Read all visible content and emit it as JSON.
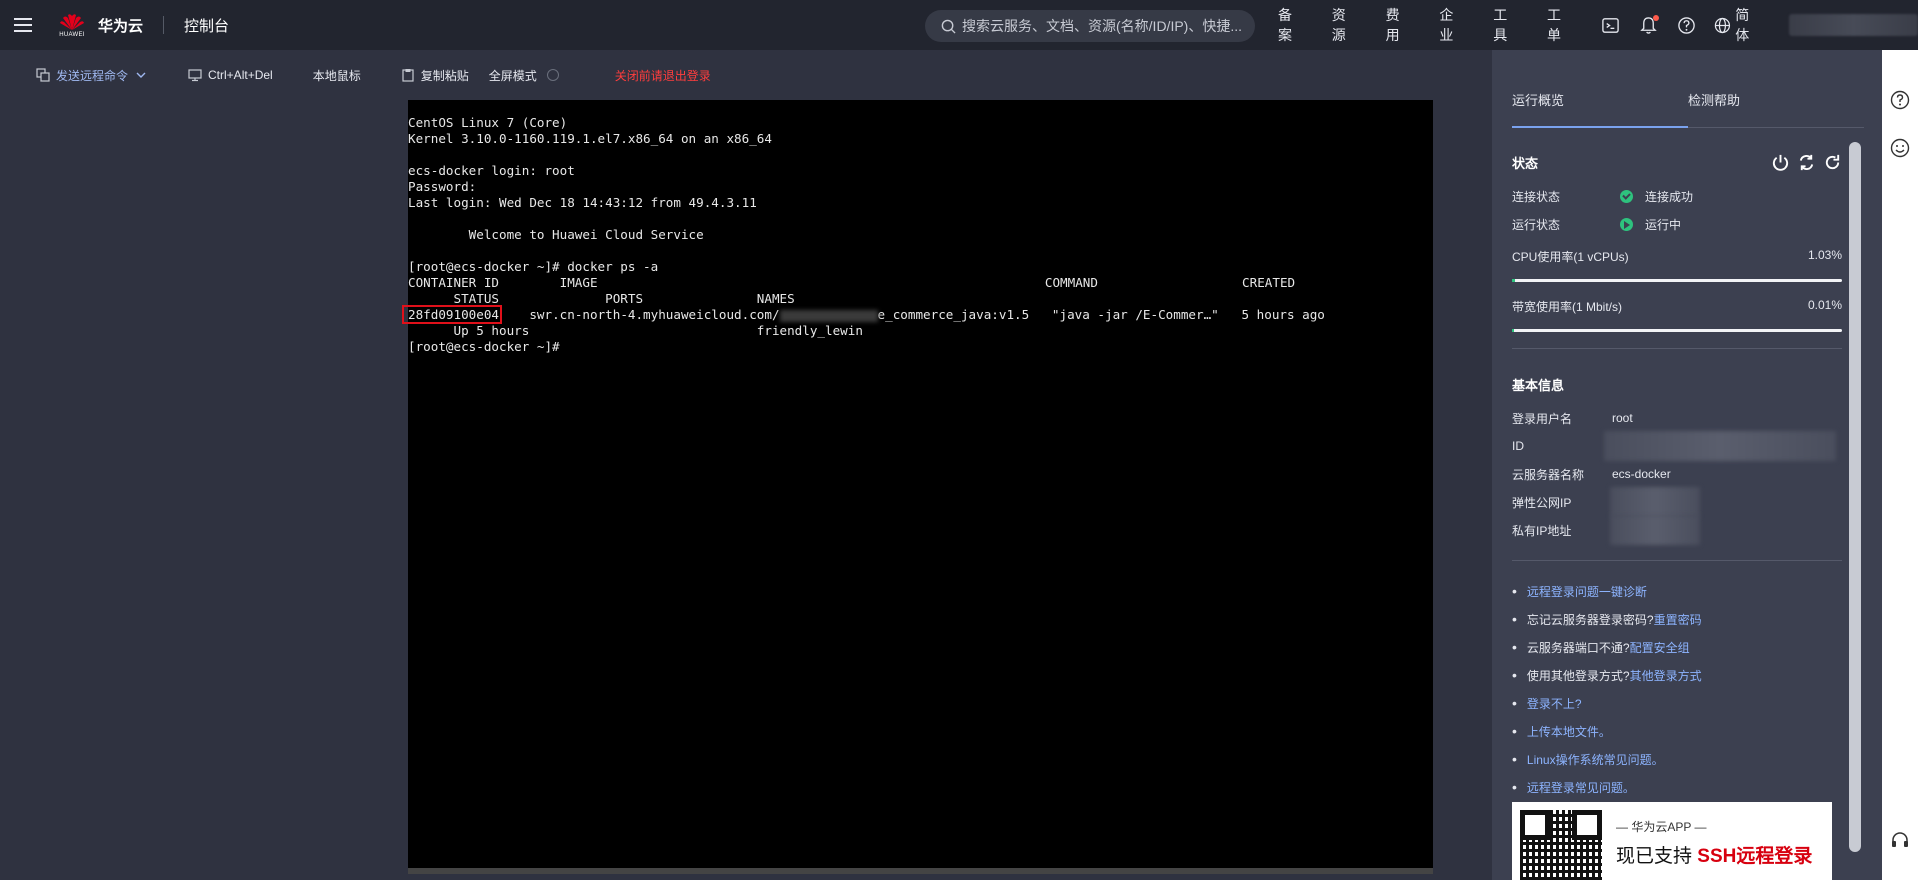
{
  "topnav": {
    "brand_name": "华为云",
    "logo_text": "HUAWEI",
    "console": "控制台",
    "search_placeholder": "搜索云服务、文档、资源(名称/ID/IP)、快捷...",
    "links": [
      "备案",
      "资源",
      "费用",
      "企业",
      "工具",
      "工单"
    ],
    "lang": "简体"
  },
  "toolbar": {
    "send_command": "发送远程命令",
    "ctrl_alt_del": "Ctrl+Alt+Del",
    "local_mouse": "本地鼠标",
    "copy_paste": "复制粘贴",
    "fullscreen": "全屏模式",
    "logout_warning": "关闭前请退出登录"
  },
  "terminal": {
    "lines_before": "CentOS Linux 7 (Core)\nKernel 3.10.0-1160.119.1.el7.x86_64 on an x86_64\n\necs-docker login: root\nPassword:\nLast login: Wed Dec 18 14:43:12 from 49.4.3.11\n\n        Welcome to Huawei Cloud Service\n\n[root@ecs-docker ~]# docker ps -a\nCONTAINER ID        IMAGE                                                           COMMAND                   CREATED\n      STATUS              PORTS               NAMES",
    "container_id": "28fd09100e04",
    "row_mid_a": "    swr.cn-north-4.myhuaweicloud.com/",
    "row_mid_b": "e_commerce_java:v1.5   \"java -jar /E-Commer…\"   5 hours ago",
    "lines_after": "      Up 5 hours                              friendly_lewin\n[root@ecs-docker ~]# "
  },
  "panel": {
    "tabs": [
      "运行概览",
      "检测帮助"
    ],
    "status_title": "状态",
    "connection_label": "连接状态",
    "connection_value": "连接成功",
    "run_label": "运行状态",
    "run_value": "运行中",
    "cpu_label": "CPU使用率(1 vCPUs)",
    "cpu_value": "1.03%",
    "cpu_fraction": 0.0103,
    "bw_label": "带宽使用率(1 Mbit/s)",
    "bw_value": "0.01%",
    "bw_fraction": 0.0001,
    "basic_title": "基本信息",
    "login_user_label": "登录用户名",
    "login_user_value": "root",
    "id_label": "ID",
    "server_name_label": "云服务器名称",
    "server_name_value": "ecs-docker",
    "eip_label": "弹性公网IP",
    "private_ip_label": "私有IP地址",
    "help": {
      "diag_link": "远程登录问题一键诊断",
      "forgot_text": "忘记云服务器登录密码?",
      "forgot_link": "重置密码",
      "port_text": "云服务器端口不通?",
      "port_link": "配置安全组",
      "other_text": "使用其他登录方式?",
      "other_link": "其他登录方式",
      "cant_login": "登录不上?",
      "upload": "上传本地文件。",
      "linux_faq": "Linux操作系统常见问题。",
      "remote_faq": "远程登录常见问题。"
    },
    "banner": {
      "sub": "— 华为云APP —",
      "main_prefix": "现已支持",
      "main_highlight": "SSH远程登录"
    }
  },
  "colors": {
    "accent": "#8db4ff",
    "success": "#2ec27e",
    "danger": "#ff3d3d",
    "highlight_box": "#e0101a"
  }
}
